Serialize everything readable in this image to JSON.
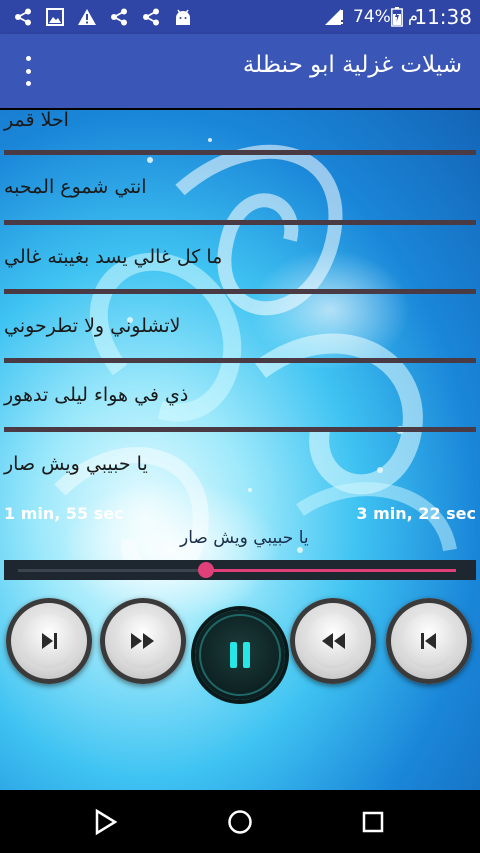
{
  "status_bar": {
    "time": "11:38",
    "battery": "74%",
    "ampm": "م",
    "left_icons": [
      "share-icon",
      "image-icon",
      "warning-icon",
      "share-icon",
      "share-icon",
      "android-icon"
    ],
    "right_icons": [
      "signal-icon",
      "alert-icon",
      "battery-icon"
    ]
  },
  "app_bar": {
    "title": "شيلات غزلية ابو حنظلة",
    "menu_icon": "overflow-menu-icon"
  },
  "songs": [
    {
      "title": "احلا قمر"
    },
    {
      "title": "انتي شموع المحبه"
    },
    {
      "title": "ما كل غالي يسد بغيبته غالي"
    },
    {
      "title": "لاتشلوني ولا تطرحوني"
    },
    {
      "title": "ذي في هواء ليلى تدهور"
    },
    {
      "title": "يا حبيبي ويش صار"
    }
  ],
  "player": {
    "elapsed": "1 min, 55 sec",
    "total": "3 min, 22 sec",
    "now_playing": "يا حبيبي ويش صار",
    "progress": 0.43,
    "colors": {
      "accent": "#e0407a",
      "track": "#3a4550"
    },
    "buttons": [
      "skip-next-icon",
      "fast-forward-icon",
      "pause-icon",
      "rewind-icon",
      "skip-previous-icon"
    ]
  },
  "nav_bar": {
    "icons": [
      "back-triangle-icon",
      "home-circle-icon",
      "recents-square-icon"
    ]
  }
}
